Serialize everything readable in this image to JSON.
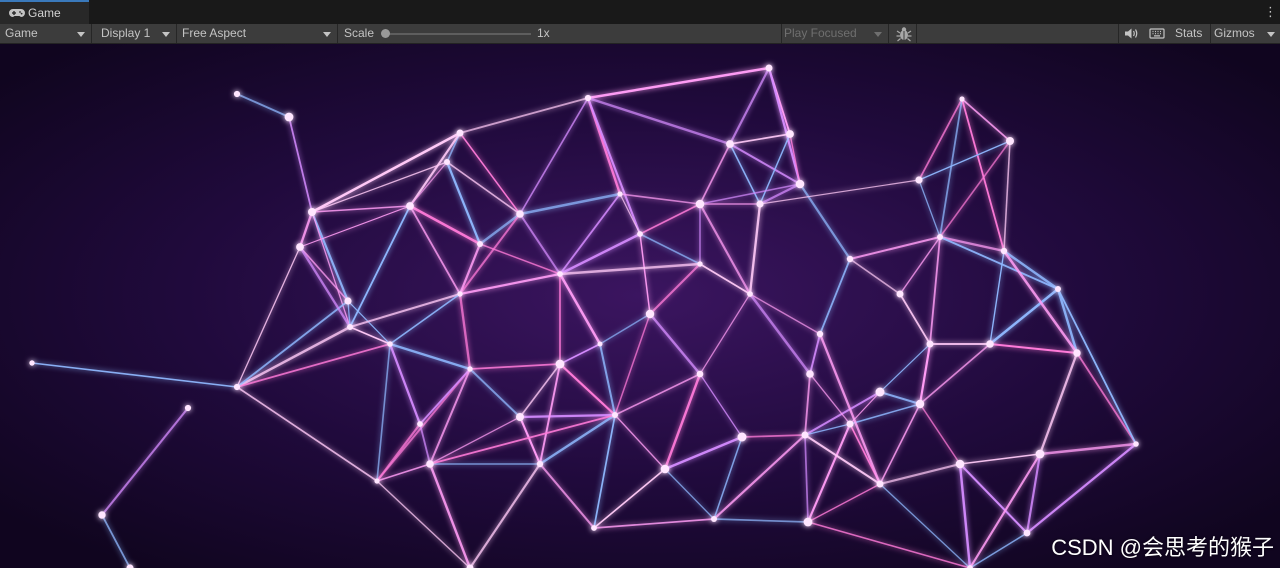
{
  "tab": {
    "title": "Game",
    "icon": "gamepad-icon"
  },
  "toolbar": {
    "view_mode": "Game",
    "display": "Display 1",
    "aspect": "Free Aspect",
    "scale_label": "Scale",
    "scale_value": "1x",
    "play_mode": "Play Focused",
    "stats_label": "Stats",
    "gizmos_label": "Gizmos",
    "icons": [
      "bug-icon",
      "speaker-icon",
      "keyboard-icon",
      "kebab-menu-icon"
    ]
  },
  "scene": {
    "background": "#10051f",
    "glow_center": "#3b1560",
    "line_colors": [
      "#ff9cf5",
      "#d58bff",
      "#8fb8ff",
      "#ffc9f7",
      "#ff7ad9"
    ],
    "node_color": "#ffe6ff"
  },
  "watermark": "CSDN @会思考的猴子"
}
